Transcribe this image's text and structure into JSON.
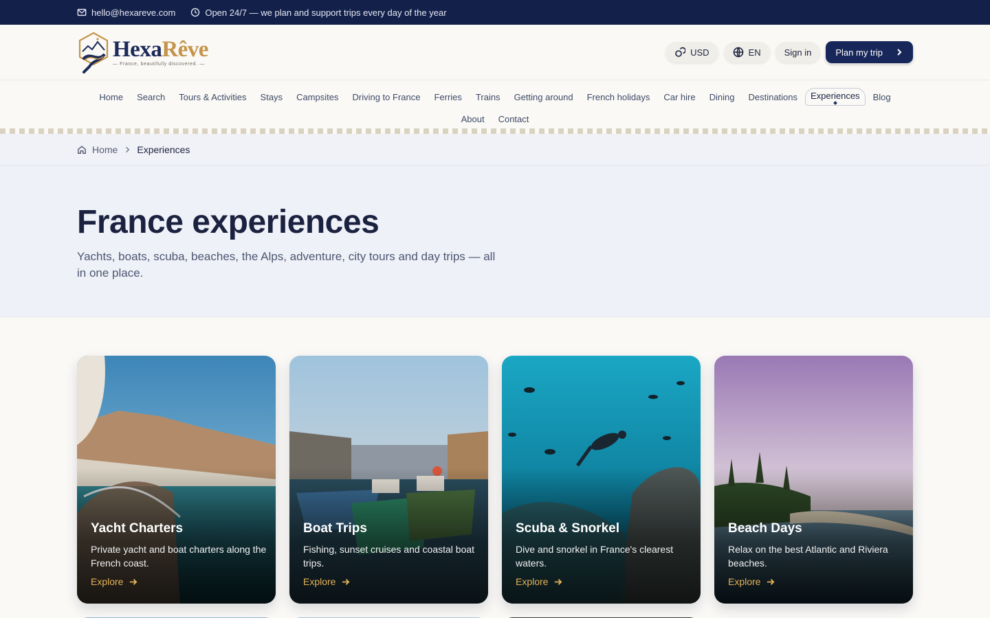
{
  "topbar": {
    "email": "hello@hexareve.com",
    "hours": "Open 24/7 — we plan and support trips every day of the year"
  },
  "brand": {
    "name_part1": "Hexa",
    "name_part2": "Rêve",
    "tagline": "— France, beautifully discovered. —"
  },
  "header": {
    "currency": "USD",
    "language": "EN",
    "signin": "Sign in",
    "cta": "Plan my trip"
  },
  "nav": {
    "items": [
      "Home",
      "Search",
      "Tours & Activities",
      "Stays",
      "Campsites",
      "Driving to France",
      "Ferries",
      "Trains",
      "Getting around",
      "French holidays",
      "Car hire",
      "Dining",
      "Destinations",
      "Experiences",
      "Blog"
    ],
    "items_row2": [
      "About",
      "Contact"
    ],
    "active": "Experiences"
  },
  "breadcrumb": {
    "home": "Home",
    "current": "Experiences"
  },
  "hero": {
    "title": "France experiences",
    "subtitle": "Yachts, boats, scuba, beaches, the Alps, adventure, city tours and day trips — all in one place."
  },
  "cards": [
    {
      "title": "Yacht Charters",
      "desc": "Private yacht and boat charters along the French coast.",
      "cta": "Explore"
    },
    {
      "title": "Boat Trips",
      "desc": "Fishing, sunset cruises and coastal boat trips.",
      "cta": "Explore"
    },
    {
      "title": "Scuba & Snorkel",
      "desc": "Dive and snorkel in France's clearest waters.",
      "cta": "Explore"
    },
    {
      "title": "Beach Days",
      "desc": "Relax on the best Atlantic and Riviera beaches.",
      "cta": "Explore"
    }
  ],
  "colors": {
    "navy": "#13204a",
    "gold": "#c4944a",
    "explore": "#e3b257"
  }
}
